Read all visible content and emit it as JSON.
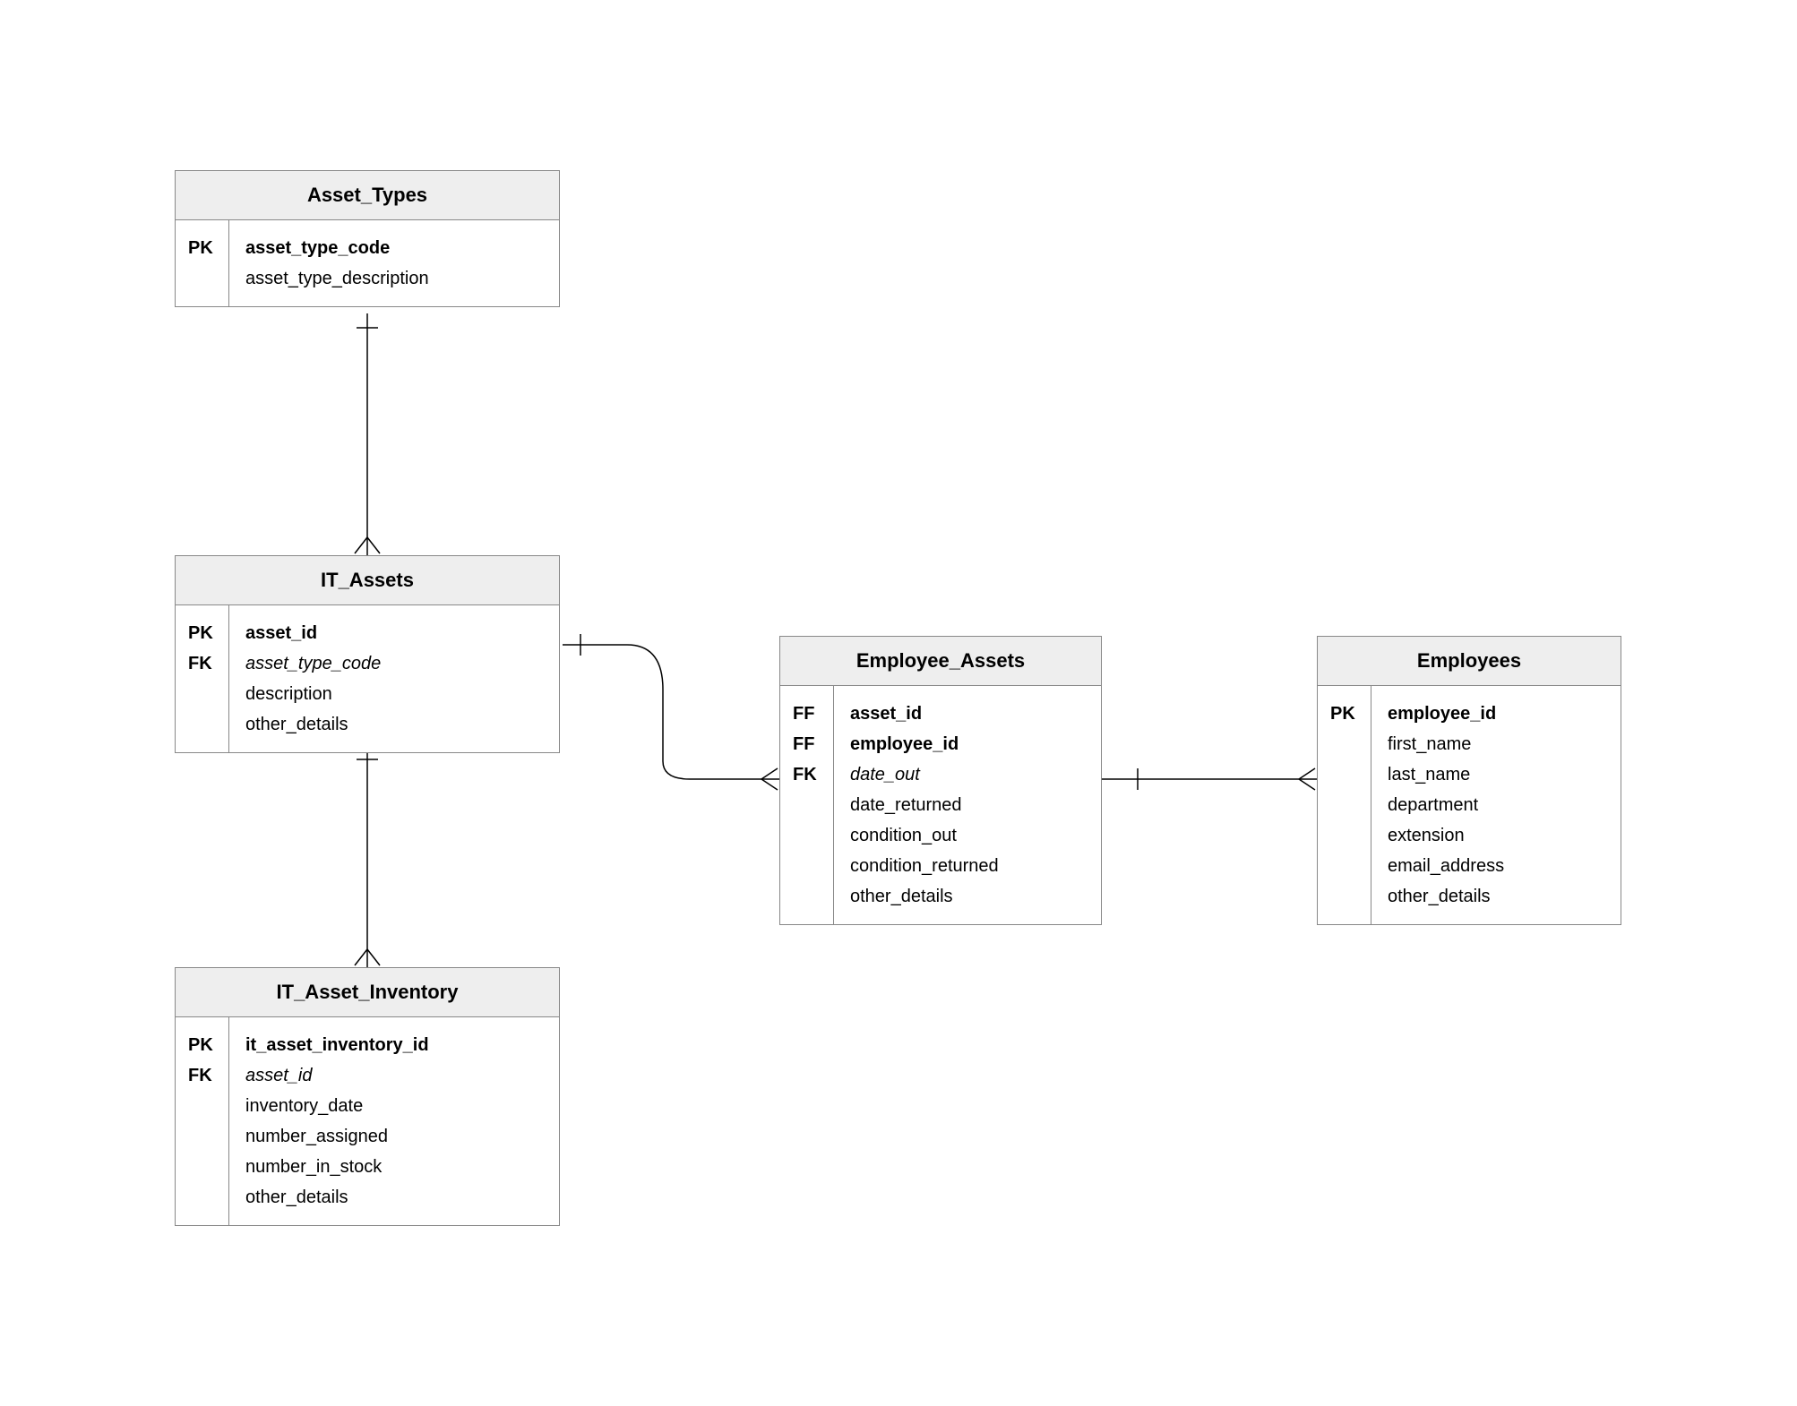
{
  "entities": {
    "asset_types": {
      "title": "Asset_Types",
      "keys": [
        "PK",
        ""
      ],
      "fields": [
        {
          "text": "asset_type_code",
          "cls": "b"
        },
        {
          "text": "asset_type_description",
          "cls": ""
        }
      ]
    },
    "it_assets": {
      "title": "IT_Assets",
      "keys": [
        "PK",
        "FK",
        "",
        ""
      ],
      "fields": [
        {
          "text": "asset_id",
          "cls": "b"
        },
        {
          "text": "asset_type_code",
          "cls": "i"
        },
        {
          "text": "description",
          "cls": ""
        },
        {
          "text": "other_details",
          "cls": ""
        }
      ]
    },
    "it_asset_inventory": {
      "title": "IT_Asset_Inventory",
      "keys": [
        "PK",
        "FK",
        "",
        "",
        "",
        ""
      ],
      "fields": [
        {
          "text": "it_asset_inventory_id",
          "cls": "b"
        },
        {
          "text": "asset_id",
          "cls": "i"
        },
        {
          "text": "inventory_date",
          "cls": ""
        },
        {
          "text": "number_assigned",
          "cls": ""
        },
        {
          "text": "number_in_stock",
          "cls": ""
        },
        {
          "text": "other_details",
          "cls": ""
        }
      ]
    },
    "employee_assets": {
      "title": "Employee_Assets",
      "keys": [
        "FF",
        "FF",
        "FK",
        "",
        "",
        "",
        ""
      ],
      "fields": [
        {
          "text": "asset_id",
          "cls": "b"
        },
        {
          "text": "employee_id",
          "cls": "b"
        },
        {
          "text": "date_out",
          "cls": "i"
        },
        {
          "text": "date_returned",
          "cls": ""
        },
        {
          "text": "condition_out",
          "cls": ""
        },
        {
          "text": "condition_returned",
          "cls": ""
        },
        {
          "text": "other_details",
          "cls": ""
        }
      ]
    },
    "employees": {
      "title": "Employees",
      "keys": [
        "PK",
        "",
        "",
        "",
        "",
        "",
        ""
      ],
      "fields": [
        {
          "text": "employee_id",
          "cls": "b"
        },
        {
          "text": "first_name",
          "cls": ""
        },
        {
          "text": "last_name",
          "cls": ""
        },
        {
          "text": "department",
          "cls": ""
        },
        {
          "text": "extension",
          "cls": ""
        },
        {
          "text": "email_address",
          "cls": ""
        },
        {
          "text": "other_details",
          "cls": ""
        }
      ]
    }
  }
}
